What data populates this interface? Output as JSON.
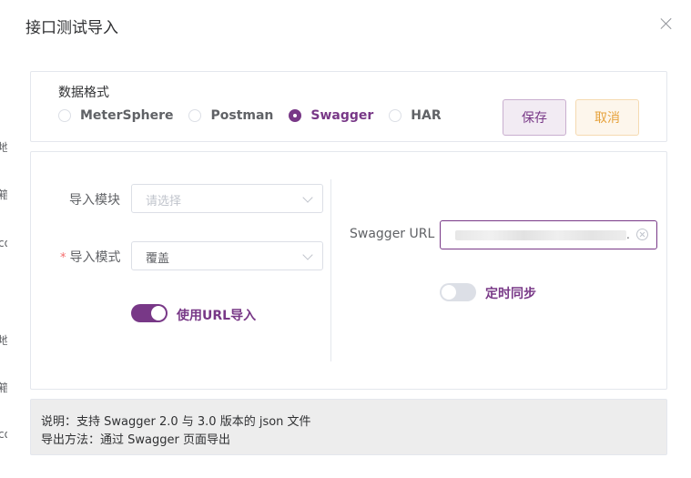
{
  "background": {
    "fragments": [
      "地",
      "箱",
      "co",
      "地",
      "箱",
      "co"
    ]
  },
  "dialog": {
    "title": "接口测试导入"
  },
  "format": {
    "label": "数据格式",
    "options": [
      {
        "label": "MeterSphere",
        "checked": false
      },
      {
        "label": "Postman",
        "checked": false
      },
      {
        "label": "Swagger",
        "checked": true
      },
      {
        "label": "HAR",
        "checked": false
      }
    ],
    "save_label": "保存",
    "cancel_label": "取消"
  },
  "settings": {
    "module_label": "导入模块",
    "module_placeholder": "请选择",
    "required_mark": "*",
    "mode_label": "导入模式",
    "mode_value": "覆盖",
    "url_toggle_label": "使用URL导入",
    "url_toggle_on": true,
    "swagger_url_label": "Swagger URL",
    "swagger_url_trailing": ".",
    "sync_label": "定时同步",
    "sync_on": false
  },
  "note": {
    "line1": "说明：支持 Swagger 2.0 与 3.0 版本的 json 文件",
    "line2": "导出方法：通过 Swagger 页面导出"
  },
  "colors": {
    "primary": "#783887",
    "warning": "#e6a23c",
    "required": "#f56c6c"
  }
}
